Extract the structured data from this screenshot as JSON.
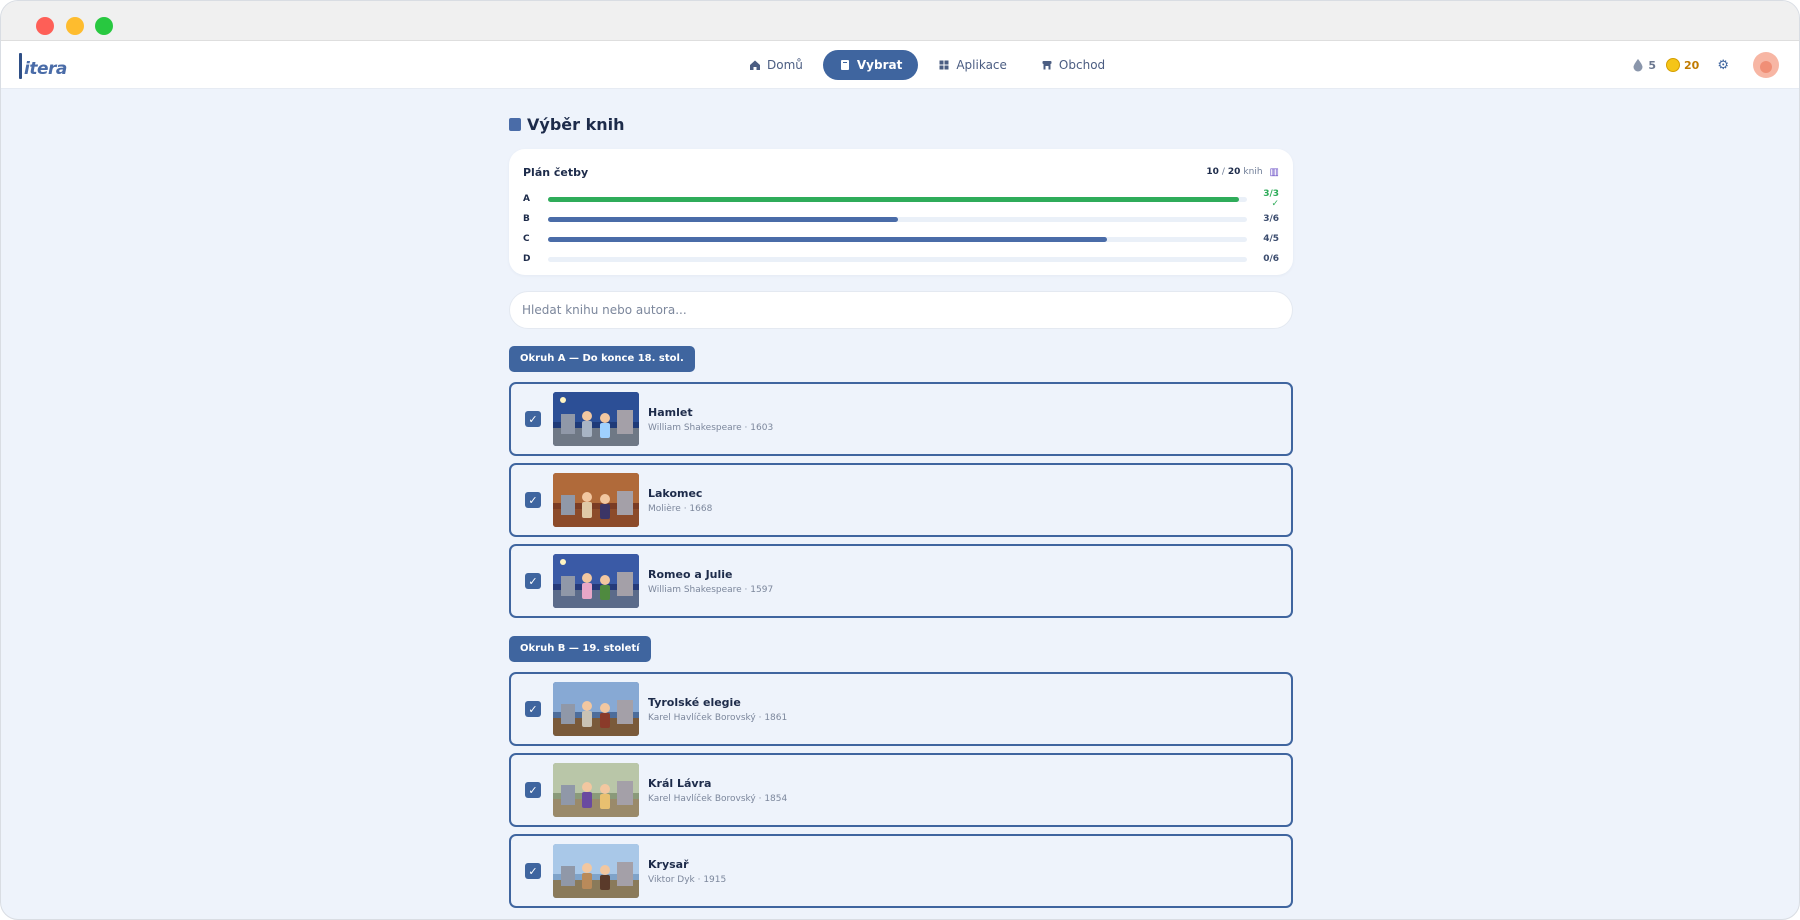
{
  "app": {
    "logo": "itera"
  },
  "nav": {
    "items": [
      {
        "label": "Domů",
        "icon": "home-icon"
      },
      {
        "label": "Vybrat",
        "icon": "book-icon",
        "active": true
      },
      {
        "label": "Aplikace",
        "icon": "grid-icon"
      },
      {
        "label": "Obchod",
        "icon": "store-icon"
      }
    ],
    "drops": "5",
    "coins": "20"
  },
  "page": {
    "title": "Výběr knih"
  },
  "plan": {
    "title": "Plán četby",
    "count_done": "10",
    "count_sep": "/",
    "count_total": "20",
    "count_unit": "knih",
    "rows": [
      {
        "label": "A",
        "value": "3/3 ✓",
        "fraction": 1.0
      },
      {
        "label": "B",
        "value": "3/6",
        "fraction": 0.5
      },
      {
        "label": "C",
        "value": "4/5",
        "fraction": 0.8
      },
      {
        "label": "D",
        "value": "0/6",
        "fraction": 0.0
      }
    ]
  },
  "search": {
    "placeholder": "Hledat knihu nebo autora...",
    "value": ""
  },
  "sections": [
    {
      "label": "Okruh A — Do konce 18. stol.",
      "books": [
        {
          "title": "Hamlet",
          "meta": "William Shakespeare · 1603",
          "checked": true
        },
        {
          "title": "Lakomec",
          "meta": "Molière · 1668",
          "checked": true
        },
        {
          "title": "Romeo a Julie",
          "meta": "William Shakespeare · 1597",
          "checked": true
        }
      ]
    },
    {
      "label": "Okruh B — 19. století",
      "books": [
        {
          "title": "Tyrolské elegie",
          "meta": "Karel Havlíček Borovský · 1861",
          "checked": true
        },
        {
          "title": "Král Lávra",
          "meta": "Karel Havlíček Borovský · 1854",
          "checked": true
        },
        {
          "title": "Krysař",
          "meta": "Viktor Dyk · 1915",
          "checked": true
        }
      ]
    }
  ],
  "colors": {
    "accent": "#3f659f",
    "done": "#2fac5a",
    "background": "#eef3fb"
  }
}
